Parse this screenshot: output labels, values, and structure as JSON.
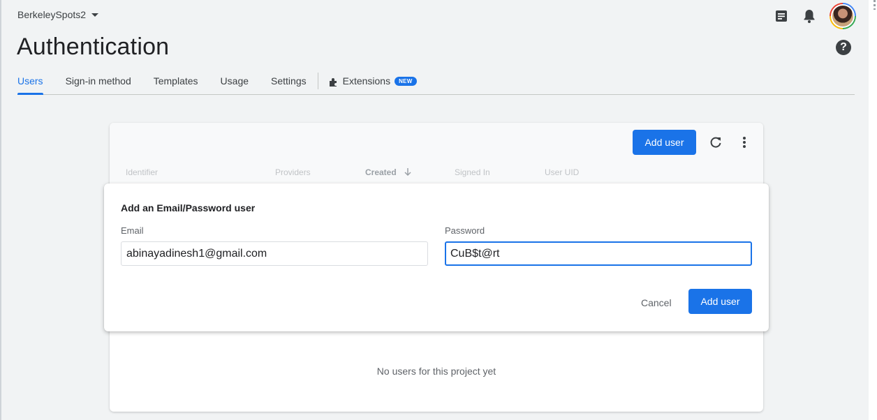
{
  "project": {
    "name": "BerkeleySpots2"
  },
  "header": {
    "title": "Authentication",
    "icons": [
      "release-notes-icon",
      "notifications-icon",
      "avatar",
      "help-icon"
    ]
  },
  "tabs": [
    {
      "label": "Users",
      "active": true
    },
    {
      "label": "Sign-in method"
    },
    {
      "label": "Templates"
    },
    {
      "label": "Usage"
    },
    {
      "label": "Settings"
    },
    {
      "label": "Extensions",
      "badge": "NEW"
    }
  ],
  "users_card": {
    "add_button": "Add user",
    "columns": [
      "Identifier",
      "Providers",
      "Created",
      "Signed In",
      "User UID"
    ],
    "sort_column": "Created",
    "empty_message": "No users for this project yet"
  },
  "dialog": {
    "title": "Add an Email/Password user",
    "email_label": "Email",
    "email_value": "abinayadinesh1@gmail.com",
    "password_label": "Password",
    "password_value": "CuB$t@rt",
    "cancel_label": "Cancel",
    "submit_label": "Add user"
  },
  "colors": {
    "accent": "#1a73e8",
    "background": "#f1f3f4"
  }
}
